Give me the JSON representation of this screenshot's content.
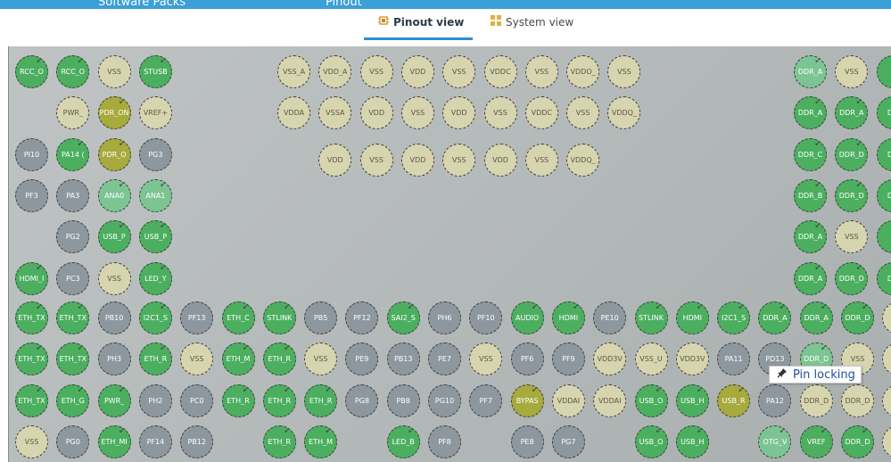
{
  "topbar": {
    "crumbs": [
      "Software Packs",
      "Pinout"
    ]
  },
  "tabs": [
    {
      "label": "Pinout view",
      "icon": "chip-icon",
      "active": true
    },
    {
      "label": "System view",
      "icon": "grid-icon",
      "active": false
    }
  ],
  "tooltip": {
    "label": "Pin locking",
    "icon": "pin-icon"
  },
  "colors": {
    "assigned": "#4caf60",
    "assigned_light": "#7cc592",
    "unassigned": "#8d979e",
    "power": "#d7d5b0",
    "reset_boot": "#a7aa3c",
    "tab_accent": "#2d8fd0",
    "topbar": "#3b9fd8"
  },
  "pins_left": [
    [
      [
        "RCC_O",
        "g"
      ],
      [
        "RCC_O",
        "g"
      ],
      [
        "VSS",
        "bg"
      ],
      [
        "STUSB",
        "g"
      ]
    ],
    [
      null,
      [
        "PWR_",
        "bg"
      ],
      [
        "PDR_ON",
        "ol"
      ],
      [
        "VREF+",
        "bg"
      ]
    ],
    [
      [
        "PI10",
        "gr"
      ],
      [
        "PA14 (",
        "g"
      ],
      [
        "PDR_O",
        "ol"
      ],
      [
        "PG3",
        "gr"
      ]
    ],
    [
      [
        "PF3",
        "gr"
      ],
      [
        "PA3",
        "gr"
      ],
      [
        "ANA0",
        "lg"
      ],
      [
        "ANA1",
        "lg"
      ]
    ],
    [
      null,
      [
        "PG2",
        "gr"
      ],
      [
        "USB_P",
        "g"
      ],
      [
        "USB_P",
        "g"
      ]
    ],
    [
      [
        "HDMI_I",
        "g"
      ],
      [
        "PC3",
        "gr"
      ],
      [
        "VSS",
        "bg"
      ],
      [
        "LED_Y",
        "g"
      ]
    ]
  ],
  "pins_center": [
    [
      [
        "VSS_A",
        "bg"
      ],
      [
        "VDD_A",
        "bg"
      ],
      [
        "VSS",
        "bg"
      ],
      [
        "VDD",
        "bg"
      ],
      [
        "VSS",
        "bg"
      ],
      [
        "VDDC",
        "bg"
      ],
      [
        "VSS",
        "bg"
      ],
      [
        "VDDO_",
        "bg"
      ],
      [
        "VSS",
        "bg"
      ]
    ],
    [
      [
        "VDDA",
        "bg"
      ],
      [
        "VSSA",
        "bg"
      ],
      [
        "VDD",
        "bg"
      ],
      [
        "VSS",
        "bg"
      ],
      [
        "VDD",
        "bg"
      ],
      [
        "VSS",
        "bg"
      ],
      [
        "VDDC",
        "bg"
      ],
      [
        "VSS",
        "bg"
      ],
      [
        "VDDQ_",
        "bg"
      ]
    ],
    [
      null,
      [
        "VDD",
        "bg"
      ],
      [
        "VSS",
        "bg"
      ],
      [
        "VDD",
        "bg"
      ],
      [
        "VSS",
        "bg"
      ],
      [
        "VDD",
        "bg"
      ],
      [
        "VSS",
        "bg"
      ],
      [
        "VDDQ_",
        "bg"
      ],
      null
    ]
  ],
  "pins_right": [
    [
      [
        "DDR_A",
        "lg"
      ],
      [
        "VSS",
        "bg"
      ],
      [
        "",
        "g"
      ]
    ],
    [
      [
        "DDR_A",
        "g"
      ],
      [
        "DDR_A",
        "g"
      ],
      [
        "DD",
        "g"
      ]
    ],
    [
      [
        "DDR_C",
        "g"
      ],
      [
        "DDR_D",
        "g"
      ],
      [
        "DD",
        "g"
      ]
    ],
    [
      [
        "DDR_B",
        "g"
      ],
      [
        "DDR_D",
        "g"
      ],
      [
        "DD",
        "g"
      ]
    ],
    [
      [
        "DDR_A",
        "g"
      ],
      [
        "VSS",
        "bg"
      ],
      [
        "",
        "g"
      ]
    ],
    [
      [
        "DDR_A",
        "g"
      ],
      [
        "DDR_D",
        "g"
      ],
      [
        "DD",
        "g"
      ]
    ]
  ],
  "pins_bottom": [
    [
      [
        "ETH_TX",
        "g"
      ],
      [
        "ETH_TX",
        "g"
      ],
      [
        "PB10",
        "gr"
      ],
      [
        "I2C1_S",
        "g"
      ],
      [
        "PF13",
        "gr"
      ],
      [
        "ETH_C",
        "g"
      ],
      [
        "STLINK",
        "g"
      ],
      [
        "PB5",
        "gr"
      ],
      [
        "PF12",
        "gr"
      ],
      [
        "SAI2_S",
        "g"
      ],
      [
        "PH6",
        "gr"
      ],
      [
        "PF10",
        "gr"
      ],
      [
        "AUDIO",
        "g"
      ],
      [
        "HDMI",
        "g"
      ],
      [
        "PE10",
        "gr"
      ],
      [
        "STLINK",
        "g"
      ],
      [
        "HDMI",
        "g"
      ],
      [
        "I2C1_S",
        "g"
      ],
      [
        "DDR_A",
        "g"
      ],
      [
        "DDR_A",
        "g"
      ],
      [
        "DDR_D",
        "g"
      ],
      [
        "DDI",
        "bg"
      ]
    ],
    [
      [
        "ETH_TX",
        "g"
      ],
      [
        "ETH_TX",
        "g"
      ],
      [
        "PH3",
        "gr"
      ],
      [
        "ETH_R",
        "g"
      ],
      [
        "VSS",
        "bg"
      ],
      [
        "ETH_M",
        "g"
      ],
      [
        "ETH_R",
        "g"
      ],
      [
        "VSS",
        "bg"
      ],
      [
        "PE9",
        "gr"
      ],
      [
        "PB13",
        "gr"
      ],
      [
        "PE7",
        "gr"
      ],
      [
        "VSS",
        "bg"
      ],
      [
        "PF6",
        "gr"
      ],
      [
        "PF9",
        "gr"
      ],
      [
        "VDD3V",
        "bg"
      ],
      [
        "VSS_U",
        "bg"
      ],
      [
        "VDD3V",
        "bg"
      ],
      [
        "PA11",
        "gr"
      ],
      [
        "PD13",
        "gr"
      ],
      [
        "DDR_D",
        "lg"
      ],
      [
        "VSS",
        "bg"
      ],
      [
        "DDI",
        "bg"
      ]
    ],
    [
      [
        "ETH_TX",
        "g"
      ],
      [
        "ETH_G",
        "g"
      ],
      [
        "PWR_",
        "g"
      ],
      [
        "PH2",
        "gr"
      ],
      [
        "PC0",
        "gr"
      ],
      [
        "ETH_R",
        "g"
      ],
      [
        "ETH_R",
        "g"
      ],
      [
        "ETH_R",
        "g"
      ],
      [
        "PG8",
        "gr"
      ],
      [
        "PB8",
        "gr"
      ],
      [
        "PG10",
        "gr"
      ],
      [
        "PF7",
        "gr"
      ],
      [
        "BYPAS",
        "ol"
      ],
      [
        "VDDAI",
        "bg"
      ],
      [
        "VDDAI",
        "bg"
      ],
      [
        "USB_O",
        "g"
      ],
      [
        "USB_H",
        "g"
      ],
      [
        "USB_R",
        "ol"
      ],
      [
        "PA12",
        "gr"
      ],
      [
        "DDR_D",
        "bg"
      ],
      [
        "DDR_D",
        "bg"
      ],
      [
        "DDI",
        "bg"
      ]
    ],
    [
      [
        "VSS",
        "bg"
      ],
      [
        "PG0",
        "gr"
      ],
      [
        "ETH_MI",
        "g"
      ],
      [
        "PF14",
        "gr"
      ],
      [
        "PB12",
        "gr"
      ],
      null,
      [
        "ETH_R",
        "g"
      ],
      [
        "ETH_M",
        "g"
      ],
      null,
      [
        "LED_B",
        "g"
      ],
      [
        "PF8",
        "gr"
      ],
      null,
      [
        "PE8",
        "gr"
      ],
      [
        "PG7",
        "gr"
      ],
      null,
      [
        "USB_O",
        "g"
      ],
      [
        "USB_H",
        "g"
      ],
      null,
      [
        "OTG_V",
        "lg"
      ],
      [
        "VREF",
        "g"
      ],
      [
        "DDR_D",
        "g"
      ],
      [
        "DDI",
        "bg"
      ]
    ]
  ]
}
